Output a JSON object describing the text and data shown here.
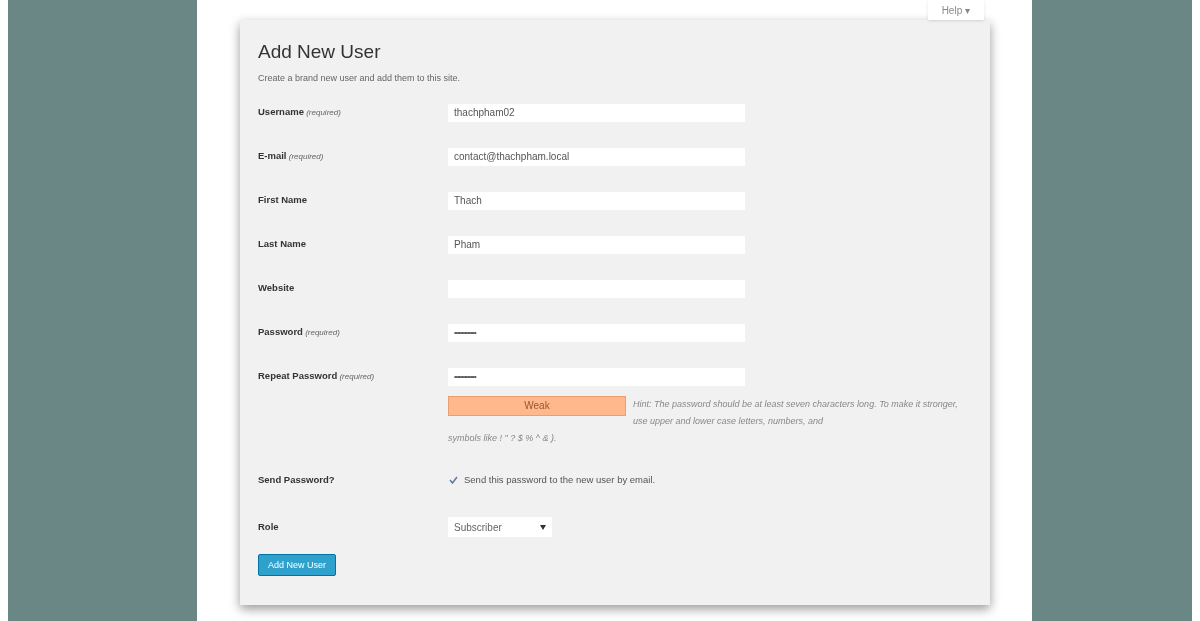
{
  "help_tab": {
    "label": "Help ▾"
  },
  "title": "Add New User",
  "description": "Create a brand new user and add them to this site.",
  "fields": [
    {
      "label": "Username",
      "note": "(required)",
      "value": "thachpham02",
      "kind": "text"
    },
    {
      "label": "E-mail",
      "note": "(required)",
      "value": "contact@thachpham.local",
      "kind": "text"
    },
    {
      "label": "First Name",
      "value": "Thach",
      "kind": "text"
    },
    {
      "label": "Last Name",
      "value": "Pham",
      "kind": "text"
    },
    {
      "label": "Website",
      "kind": "text"
    },
    {
      "label": "Password",
      "note": "(required)",
      "value": "•••••••••••••••",
      "kind": "password"
    },
    {
      "label": "Repeat Password",
      "note": "(required)",
      "value": "•••••••••••••••",
      "kind": "password"
    }
  ],
  "strength": {
    "label": "Weak",
    "color": "#ffb78c"
  },
  "hint": "Hint: The password should be at least seven characters long. To make it stronger, use upper and lower case letters, numbers, and",
  "hint_continued": "symbols like ! \" ? $ % ^ & ).",
  "send_password": {
    "label": "Send Password?",
    "checkbox_label": "Send this password to the new user by email.",
    "checked": true
  },
  "role": {
    "label": "Role",
    "value": "Subscriber"
  },
  "submit": "Add New User"
}
